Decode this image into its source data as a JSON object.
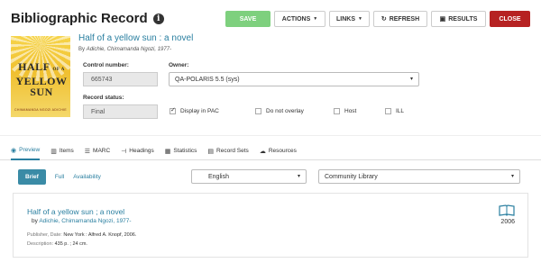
{
  "header": {
    "title": "Bibliographic Record",
    "toolbar": {
      "save": "SAVE",
      "actions": "ACTIONS",
      "links": "LINKS",
      "refresh": "REFRESH",
      "results": "RESULTS",
      "close": "CLOSE"
    }
  },
  "cover": {
    "title_line1": "HALF",
    "title_of_a": "OF A",
    "title_line2": "YELLOW",
    "title_line3": "SUN",
    "author": "CHIMAMANDA NGOZI ADICHIE"
  },
  "record": {
    "title": "Half of a yellow sun : a novel",
    "author_prefix": "By",
    "author": "Adichie, Chimamanda Ngozi, 1977-",
    "control_number_label": "Control number:",
    "control_number": "665743",
    "owner_label": "Owner:",
    "owner": "QA-POLARIS 5.5 (sys)",
    "status_label": "Record status:",
    "status": "Final",
    "checkboxes": [
      {
        "label": "Display in PAC",
        "checked": true
      },
      {
        "label": "Do not overlay",
        "checked": false
      },
      {
        "label": "Host",
        "checked": false
      },
      {
        "label": "ILL",
        "checked": false
      }
    ]
  },
  "tabs": [
    {
      "label": "Preview",
      "icon": "eye-icon",
      "active": true
    },
    {
      "label": "Items",
      "icon": "books-icon",
      "active": false
    },
    {
      "label": "MARC",
      "icon": "list-icon",
      "active": false
    },
    {
      "label": "Headings",
      "icon": "tree-icon",
      "active": false
    },
    {
      "label": "Statistics",
      "icon": "chart-icon",
      "active": false
    },
    {
      "label": "Record Sets",
      "icon": "folder-icon",
      "active": false
    },
    {
      "label": "Resources",
      "icon": "cloud-icon",
      "active": false
    }
  ],
  "preview": {
    "subtabs": {
      "brief": "Brief",
      "full": "Full",
      "availability": "Availability"
    },
    "language": "English",
    "library": "Community Library",
    "card": {
      "title": "Half of a yellow sun ; a novel",
      "author_prefix": "by",
      "author": "Adichie, Chimamanda Ngozi, 1977-",
      "publisher_label": "Publisher, Date:",
      "publisher": "New York : Alfred A. Knopf, 2006.",
      "description_label": "Description:",
      "description": "435 p. ; 24 cm.",
      "year": "2006"
    }
  }
}
